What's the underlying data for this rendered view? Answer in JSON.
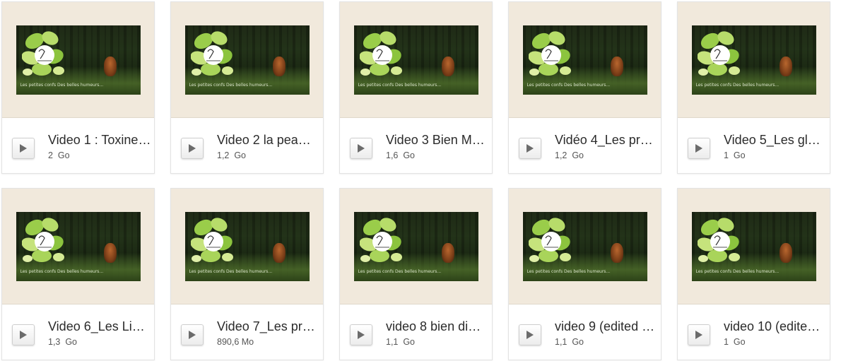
{
  "videos": [
    {
      "title": "Video 1 : Toxines…",
      "size": "2  Go",
      "thumb_caption": "Les petites confs Des belles humeurs..."
    },
    {
      "title": "Video 2 la pea…",
      "size": "1,2  Go",
      "thumb_caption": "Les petites confs Des belles humeurs..."
    },
    {
      "title": "Video 3 Bien M…",
      "size": "1,6  Go",
      "thumb_caption": "Les petites confs Des belles humeurs..."
    },
    {
      "title": "Vidéo 4_Les pr…",
      "size": "1,2  Go",
      "thumb_caption": "Les petites confs Des belles humeurs..."
    },
    {
      "title": "Video 5_Les gl…",
      "size": "1  Go",
      "thumb_caption": "Les petites confs Des belles humeurs..."
    },
    {
      "title": "Video 6_Les Li…",
      "size": "1,3  Go",
      "thumb_caption": "Les petites confs Des belles humeurs..."
    },
    {
      "title": "Video 7_Les pr…",
      "size": "890,6 Mo",
      "thumb_caption": "Les petites confs Des belles humeurs..."
    },
    {
      "title": "video 8 bien di…",
      "size": "1,1  Go",
      "thumb_caption": "Les petites confs Des belles humeurs..."
    },
    {
      "title": "video 9 (edited …",
      "size": "1,1  Go",
      "thumb_caption": "Les petites confs Des belles humeurs..."
    },
    {
      "title": "video 10 (edite…",
      "size": "1  Go",
      "thumb_caption": "Les petites confs Des belles humeurs..."
    }
  ],
  "icons": {
    "play": "play-icon",
    "logo": "belles-humeurs-logo"
  },
  "colors": {
    "card_bg": "#f1e9dc",
    "text": "#2b2b2b",
    "meta": "#555555"
  }
}
